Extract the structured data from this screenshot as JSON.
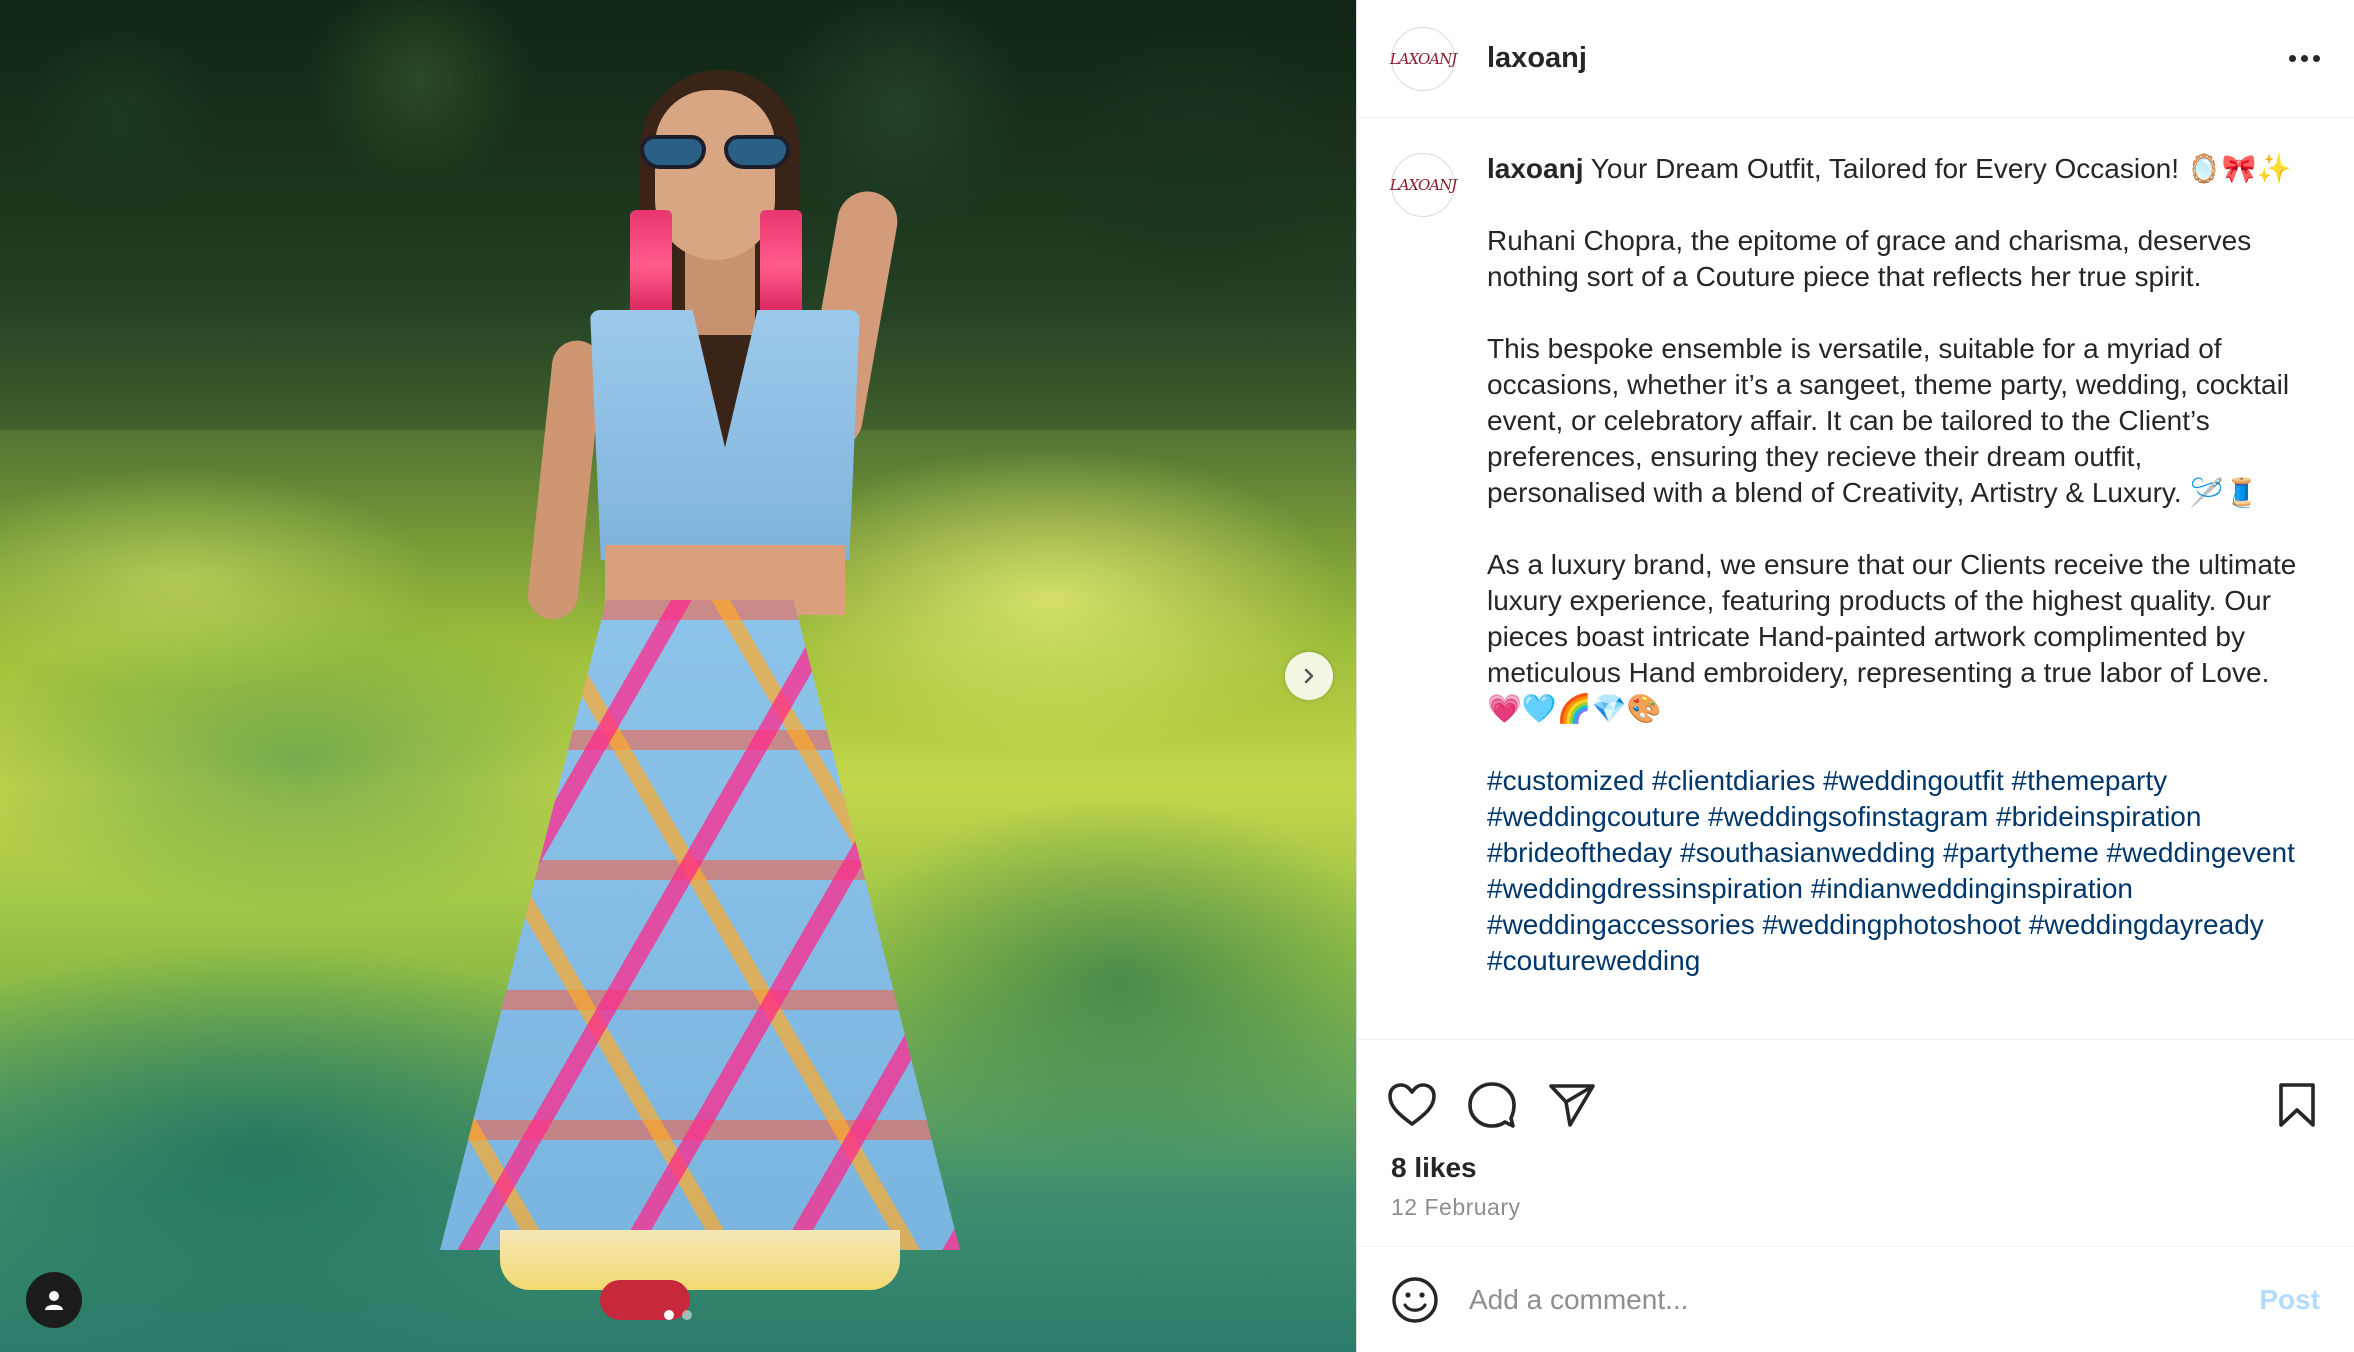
{
  "post": {
    "username": "laxoanj",
    "avatar_text": "LAXOANJ",
    "media": {
      "carousel_dots": 2,
      "active_index": 0
    },
    "caption": {
      "username": "laxoanj",
      "first_line": "Your Dream Outfit, Tailored for Every Occasion!",
      "first_line_emoji": "🪞🎀✨",
      "p1": "Ruhani Chopra, the epitome of grace and charisma, deserves nothing sort of a Couture piece that reflects her true spirit.",
      "p2": "This bespoke ensemble is versatile, suitable for a myriad of occasions, whether it’s a sangeet, theme party, wedding, cocktail event, or celebratory affair. It can be tailored to the Client’s preferences, ensuring they recieve their dream outfit, personalised with a blend of Creativity, Artistry & Luxury.",
      "p2_emoji": "🪡🧵",
      "p3": "As a luxury brand, we ensure that our Clients receive the ultimate luxury experience, featuring products of the highest quality. Our pieces boast intricate Hand-painted artwork complimented by meticulous Hand embroidery, representing a true labor of Love.",
      "p3_emoji": "💗🩵🌈💎🎨",
      "hashtags": "#customized #clientdiaries #weddingoutfit #themeparty #weddingcouture #weddingsofinstagram #brideinspiration #brideoftheday #southasianwedding #partytheme #weddingevent #weddingdressinspiration #indianweddinginspiration #weddingaccessories #weddingphotoshoot #weddingdayready #couturewedding"
    },
    "likes": "8 likes",
    "date": "12 February",
    "comment_placeholder": "Add a comment...",
    "post_label": "Post"
  },
  "icons": {
    "more": "more-options-icon",
    "like": "heart-icon",
    "comment": "comment-icon",
    "share": "send-icon",
    "save": "bookmark-icon",
    "emoji": "smiley-icon",
    "next": "chevron-right-icon",
    "tag": "user-tag-icon"
  },
  "colors": {
    "hashtag": "#00376b",
    "post_disabled": "#b3dbff",
    "muted": "#8e8e8e"
  }
}
